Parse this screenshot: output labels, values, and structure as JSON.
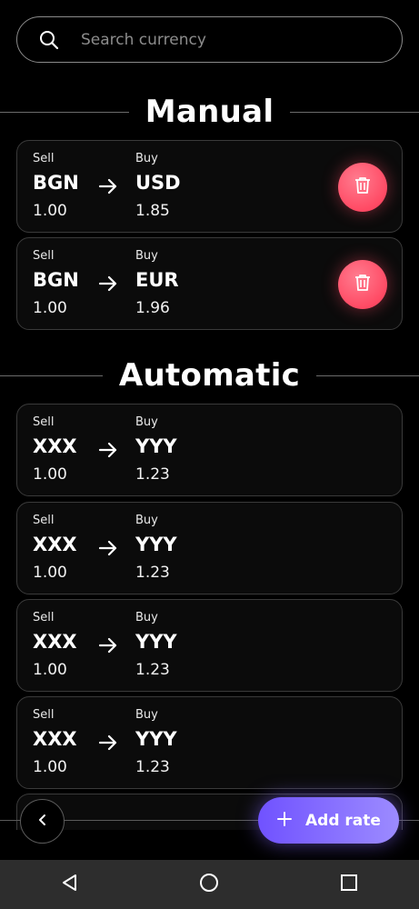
{
  "search": {
    "placeholder": "Search currency"
  },
  "sections": {
    "manual": "Manual",
    "automatic": "Automatic"
  },
  "labels": {
    "sell": "Sell",
    "buy": "Buy"
  },
  "manual_rates": [
    {
      "sell_code": "BGN",
      "sell_amount": "1.00",
      "buy_code": "USD",
      "buy_amount": "1.85"
    },
    {
      "sell_code": "BGN",
      "sell_amount": "1.00",
      "buy_code": "EUR",
      "buy_amount": "1.96"
    }
  ],
  "automatic_rates": [
    {
      "sell_code": "XXX",
      "sell_amount": "1.00",
      "buy_code": "YYY",
      "buy_amount": "1.23"
    },
    {
      "sell_code": "XXX",
      "sell_amount": "1.00",
      "buy_code": "YYY",
      "buy_amount": "1.23"
    },
    {
      "sell_code": "XXX",
      "sell_amount": "1.00",
      "buy_code": "YYY",
      "buy_amount": "1.23"
    },
    {
      "sell_code": "XXX",
      "sell_amount": "1.00",
      "buy_code": "YYY",
      "buy_amount": "1.23"
    }
  ],
  "actions": {
    "add_rate": "Add rate"
  },
  "icons": {
    "search": "search-icon",
    "arrow": "arrow-right-icon",
    "delete": "trash-icon",
    "back": "chevron-left-icon",
    "add": "plus-icon",
    "nav_back": "triangle-back-icon",
    "nav_home": "circle-home-icon",
    "nav_recents": "square-recents-icon"
  },
  "colors": {
    "delete_button": "#ff4a64",
    "add_button": "#7052ff",
    "background": "#000000",
    "card_border": "#3a3a3a"
  }
}
